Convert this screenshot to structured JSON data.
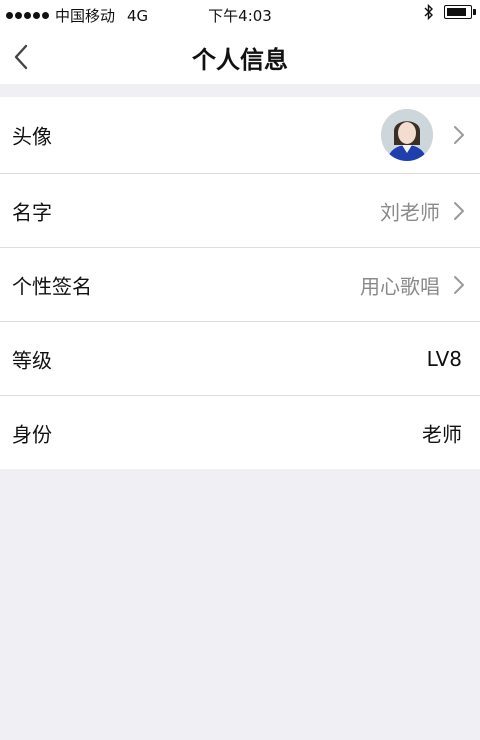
{
  "status_bar": {
    "carrier": "中国移动",
    "network": "4G",
    "time": "下午4:03",
    "battery_level": 0.85,
    "icons": [
      "signal-dots-icon",
      "bluetooth-icon",
      "battery-icon"
    ]
  },
  "nav": {
    "title": "个人信息",
    "back_icon": "chevron-left-icon"
  },
  "rows": [
    {
      "label": "头像",
      "value": "",
      "has_avatar": true,
      "has_chevron": true
    },
    {
      "label": "名字",
      "value": "刘老师",
      "has_chevron": true
    },
    {
      "label": "个性签名",
      "value": "用心歌唱",
      "has_chevron": true
    },
    {
      "label": "等级",
      "value": "LV8",
      "has_chevron": false
    },
    {
      "label": "身份",
      "value": "老师",
      "has_chevron": false
    }
  ],
  "colors": {
    "background": "#efeff4",
    "value_gray": "#8a8a8a",
    "chevron": "#9a9a9a",
    "avatar_jacket": "#1f3fae"
  }
}
